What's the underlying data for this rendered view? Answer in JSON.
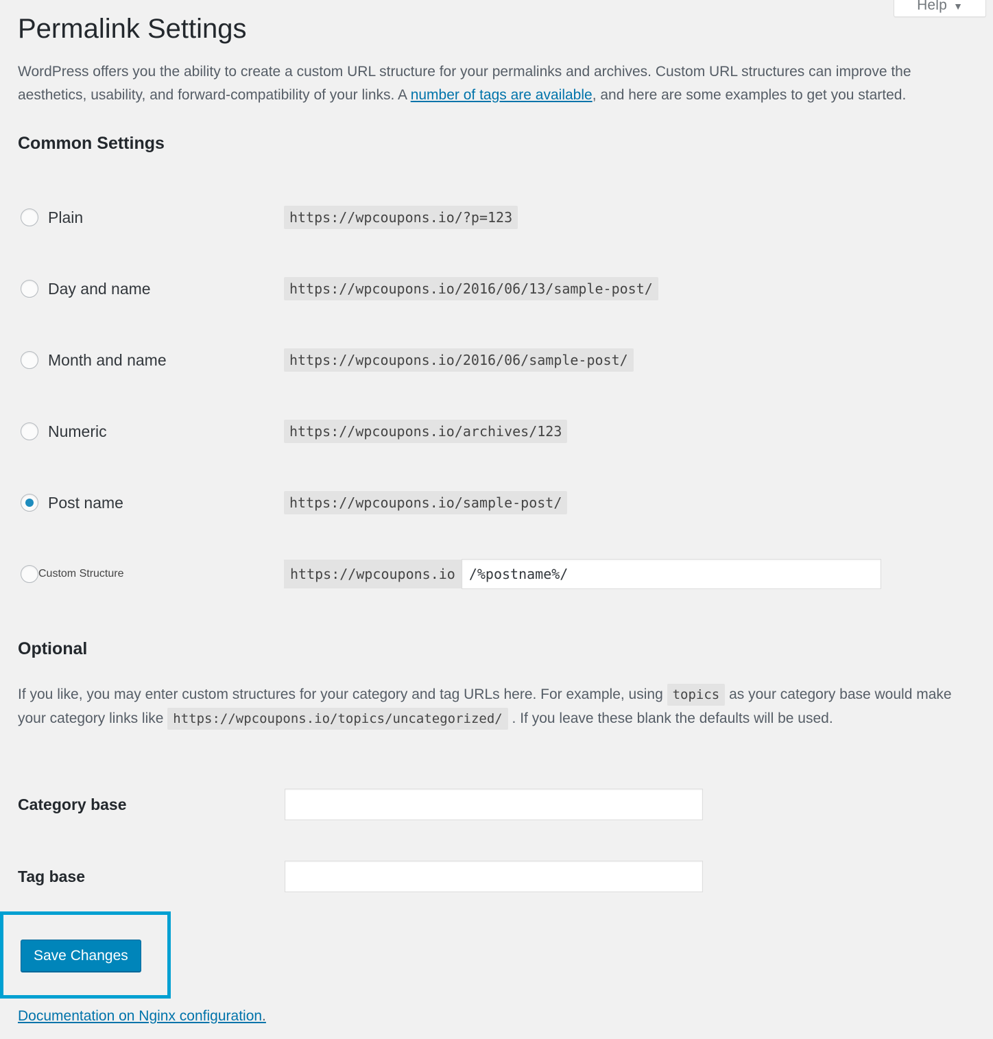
{
  "header": {
    "help_label": "Help",
    "help_caret": "▼"
  },
  "page": {
    "title": "Permalink Settings",
    "intro_part1": "WordPress offers you the ability to create a custom URL structure for your permalinks and archives. Custom URL structures can improve the aesthetics, usability, and forward-compatibility of your links. A ",
    "intro_link": "number of tags are available",
    "intro_part2": ", and here are some examples to get you started."
  },
  "common_settings": {
    "heading": "Common Settings",
    "options": [
      {
        "label": "Plain",
        "example": "https://wpcoupons.io/?p=123",
        "selected": false
      },
      {
        "label": "Day and name",
        "example": "https://wpcoupons.io/2016/06/13/sample-post/",
        "selected": false
      },
      {
        "label": "Month and name",
        "example": "https://wpcoupons.io/2016/06/sample-post/",
        "selected": false
      },
      {
        "label": "Numeric",
        "example": "https://wpcoupons.io/archives/123",
        "selected": false
      },
      {
        "label": "Post name",
        "example": "https://wpcoupons.io/sample-post/",
        "selected": true
      }
    ],
    "custom": {
      "label": "Custom Structure",
      "prefix": "https://wpcoupons.io",
      "value": "/%postname%/"
    }
  },
  "optional": {
    "heading": "Optional",
    "text_part1": "If you like, you may enter custom structures for your category and tag URLs here. For example, using ",
    "code_topics": "topics",
    "text_part2": " as your category base would make your category links like ",
    "code_url": "https://wpcoupons.io/topics/uncategorized/",
    "text_part3": " . If you leave these blank the defaults will be used.",
    "category_base": {
      "label": "Category base",
      "value": "",
      "placeholder": ""
    },
    "tag_base": {
      "label": "Tag base",
      "value": "",
      "placeholder": ""
    }
  },
  "footer": {
    "save_label": "Save Changes",
    "doc_link": "Documentation on Nginx configuration",
    "doc_period": "."
  },
  "colors": {
    "page_bg": "#f1f1f1",
    "accent_blue": "#0073aa",
    "button_blue": "#0085ba",
    "highlight_blue": "#00a0d2",
    "radio_dot": "#1e8cbe",
    "code_bg": "#e3e3e3",
    "heading_text": "#23282d",
    "body_text": "#555d66"
  }
}
